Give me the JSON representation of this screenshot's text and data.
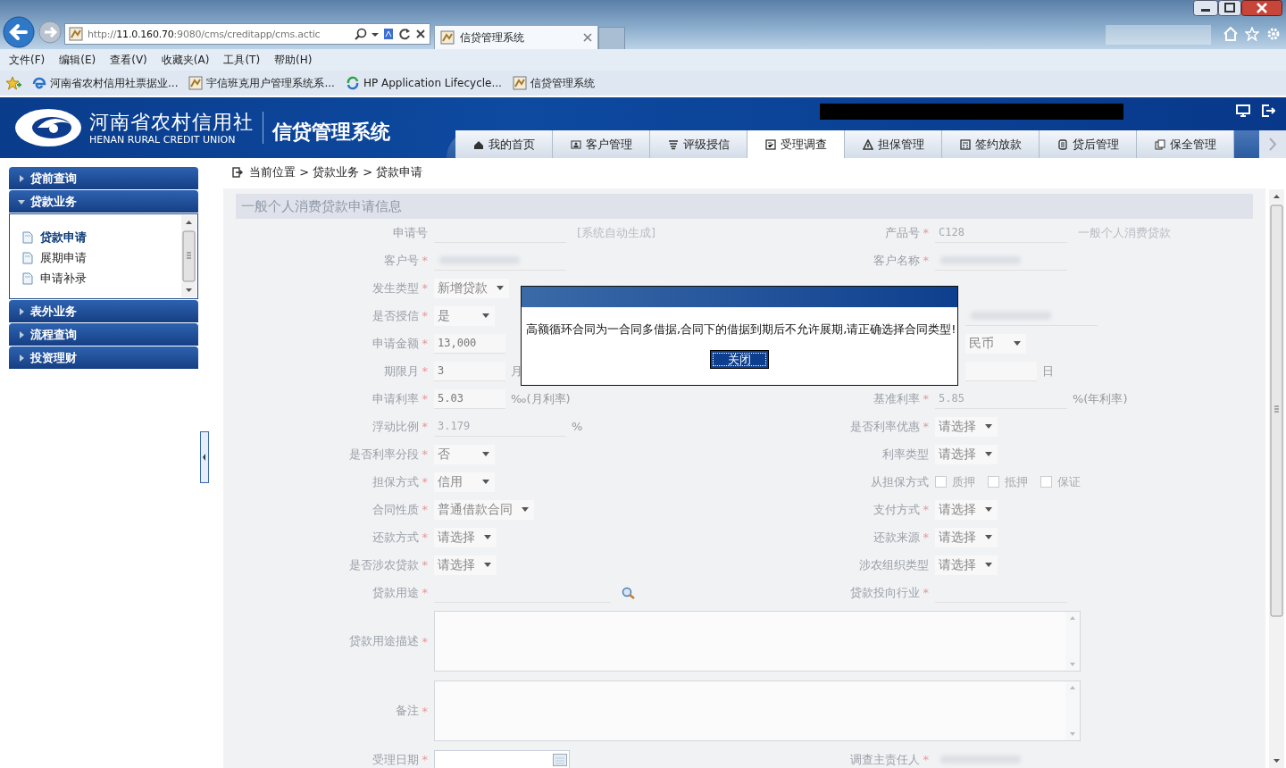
{
  "browser": {
    "address": "http://**11.0.160.70**:9080/cms/creditapp/cms.actic",
    "tab_title": "信贷管理系统",
    "menu": [
      "文件(F)",
      "编辑(E)",
      "查看(V)",
      "收藏夹(A)",
      "工具(T)",
      "帮助(H)"
    ],
    "favorites": [
      {
        "label": "河南省农村信用社票据业...",
        "kind": "ie"
      },
      {
        "label": "宇信班克用户管理系统系...",
        "kind": "page"
      },
      {
        "label": "HP Application Lifecycle...",
        "kind": "hp"
      },
      {
        "label": "信贷管理系统",
        "kind": "page"
      }
    ]
  },
  "app": {
    "logo_cn": "河南省农村信用社",
    "logo_en": "HENAN RURAL CREDIT UNION",
    "system_name": "信贷管理系统",
    "nav": [
      {
        "label": "我的首页",
        "selected": false
      },
      {
        "label": "客户管理",
        "selected": false
      },
      {
        "label": "评级授信",
        "selected": false
      },
      {
        "label": "受理调查",
        "selected": true
      },
      {
        "label": "担保管理",
        "selected": false
      },
      {
        "label": "签约放款",
        "selected": false
      },
      {
        "label": "贷后管理",
        "selected": false
      },
      {
        "label": "保全管理",
        "selected": false
      }
    ]
  },
  "sidebar": {
    "groups": [
      {
        "label": "贷前查询",
        "expanded": false
      },
      {
        "label": "贷款业务",
        "expanded": true,
        "children": [
          {
            "label": "贷款申请",
            "selected": true
          },
          {
            "label": "展期申请",
            "selected": false
          },
          {
            "label": "申请补录",
            "selected": false
          }
        ]
      },
      {
        "label": "表外业务",
        "expanded": false
      },
      {
        "label": "流程查询",
        "expanded": false
      },
      {
        "label": "投资理财",
        "expanded": false
      }
    ]
  },
  "breadcrumb": "当前位置 > 贷款业务 > 贷款申请",
  "form": {
    "title": "一般个人消费贷款申请信息",
    "rows": [
      {
        "left": {
          "label": "申请号",
          "kind": "text",
          "readonly": true,
          "note": "[系统自动生成]"
        },
        "right": {
          "label": "产品号",
          "mark": "*",
          "kind": "text",
          "readonly": true,
          "value": "C128",
          "note": "一般个人消费贷款"
        }
      },
      {
        "left": {
          "label": "客户号",
          "mark": "*",
          "kind": "text",
          "readonly": true,
          "redacted": true
        },
        "right": {
          "label": "客户名称",
          "mark": "*",
          "kind": "text",
          "readonly": true,
          "redacted": true
        }
      },
      {
        "left": {
          "label": "发生类型",
          "mark": "*",
          "kind": "select",
          "value": "新增贷款"
        }
      },
      {
        "left": {
          "label": "是否授信",
          "mark": "*",
          "kind": "select",
          "value": "是"
        },
        "right": {
          "kind": "text",
          "covered": true,
          "readonly": true,
          "redacted": true
        }
      },
      {
        "left": {
          "label": "申请金额",
          "mark": "*",
          "kind": "text",
          "value": "13,000"
        },
        "right": {
          "kind": "select",
          "covered": true,
          "value": "民币"
        }
      },
      {
        "left": {
          "label": "期限月",
          "mark": "*",
          "kind": "text",
          "value": "3",
          "unit": "月"
        },
        "right": {
          "kind": "text",
          "covered": true,
          "unit": "日"
        }
      },
      {
        "left": {
          "label": "申请利率",
          "mark": "*",
          "kind": "text",
          "value": "5.03",
          "unit": "‰(月利率)"
        },
        "right": {
          "label": "基准利率",
          "mark": "*",
          "kind": "text",
          "readonly": true,
          "value": "5.85",
          "unit": "%(年利率)"
        }
      },
      {
        "left": {
          "label": "浮动比例",
          "mark": "*",
          "kind": "text",
          "readonly": true,
          "value": "3.179",
          "unit": "%"
        },
        "right": {
          "label": "是否利率优惠",
          "mark": "*",
          "kind": "select",
          "value": "请选择"
        }
      },
      {
        "left": {
          "label": "是否利率分段",
          "mark": "*",
          "kind": "select",
          "value": "否"
        },
        "right": {
          "label": "利率类型",
          "kind": "select",
          "value": "请选择"
        }
      },
      {
        "left": {
          "label": "担保方式",
          "mark": "*",
          "kind": "select",
          "value": "信用"
        },
        "right": {
          "label": "从担保方式",
          "kind": "checkboxes",
          "options": [
            {
              "label": "质押",
              "checked": false
            },
            {
              "label": "抵押",
              "checked": false
            },
            {
              "label": "保证",
              "checked": false
            }
          ]
        }
      },
      {
        "left": {
          "label": "合同性质",
          "mark": "*",
          "kind": "select",
          "value": "普通借款合同"
        },
        "right": {
          "label": "支付方式",
          "mark": "*",
          "kind": "select",
          "value": "请选择"
        }
      },
      {
        "left": {
          "label": "还款方式",
          "mark": "*",
          "kind": "select",
          "value": "请选择"
        },
        "right": {
          "label": "还款来源",
          "mark": "*",
          "kind": "select",
          "value": "请选择"
        }
      },
      {
        "left": {
          "label": "是否涉农贷款",
          "mark": "*",
          "kind": "select",
          "value": "请选择"
        },
        "right": {
          "label": "涉农组织类型",
          "kind": "select",
          "value": "请选择"
        }
      },
      {
        "left": {
          "label": "贷款用途",
          "mark": "*",
          "kind": "search"
        },
        "right": {
          "label": "贷款投向行业",
          "mark": "*",
          "kind": "text",
          "readonly": true
        }
      },
      {
        "full": {
          "label": "贷款用途描述",
          "mark": "*",
          "kind": "textarea"
        }
      },
      {
        "full": {
          "label": "备注",
          "mark": "*",
          "kind": "textarea"
        }
      },
      {
        "left": {
          "label": "受理日期",
          "mark": "*",
          "kind": "date"
        },
        "right": {
          "label": "调查主责任人",
          "mark": "*",
          "kind": "text",
          "readonly": true,
          "redacted": true
        }
      }
    ]
  },
  "dialog": {
    "message": "高额循环合同为一合同多借据,合同下的借据到期后不允许展期,请正确选择合同类型!",
    "button": "关闭"
  }
}
